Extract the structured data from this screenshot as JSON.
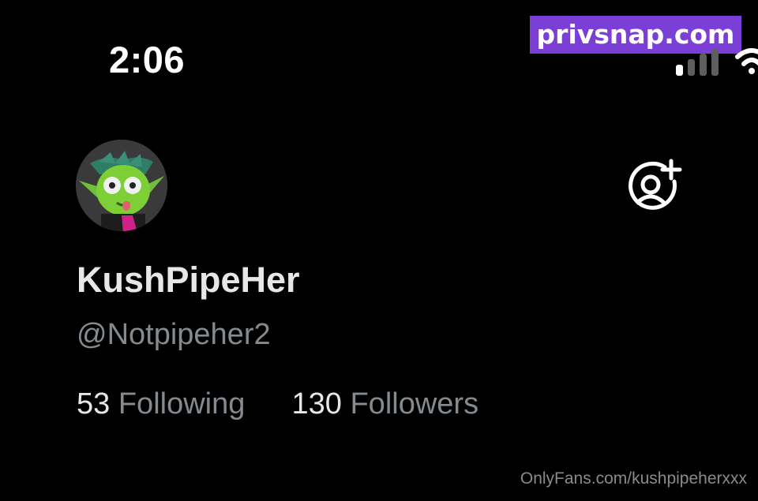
{
  "status_bar": {
    "time": "2:06",
    "signal_icon": "cellular-signal-icon",
    "wifi_icon": "wifi-icon"
  },
  "watermark": {
    "text": "privsnap.com",
    "color": "#7b3fd8"
  },
  "profile": {
    "display_name": "KushPipeHer",
    "handle": "@Notpipeher2",
    "avatar_icon": "avatar",
    "follow_icon": "add-user-icon",
    "following_count": "53",
    "following_label": "Following",
    "followers_count": "130",
    "followers_label": "Followers"
  },
  "footer": {
    "link_text": "OnlyFans.com/kushpipeherxxx"
  },
  "colors": {
    "background": "#000000",
    "text_primary": "#e7e7e7",
    "text_secondary": "#858a8f"
  }
}
